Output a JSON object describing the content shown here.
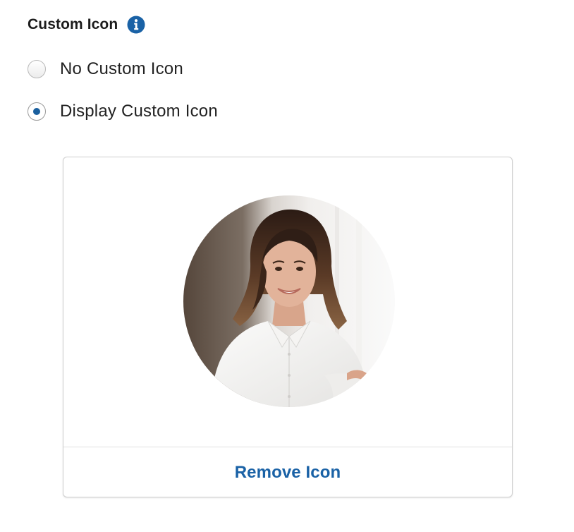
{
  "section": {
    "title": "Custom Icon",
    "info_icon": "info-icon"
  },
  "options": [
    {
      "label": "No Custom Icon",
      "selected": false
    },
    {
      "label": "Display Custom Icon",
      "selected": true
    }
  ],
  "card": {
    "preview": "avatar-photo",
    "remove_label": "Remove Icon"
  },
  "colors": {
    "accent": "#1a62a6",
    "radio_checked": "#1a5f9e",
    "card_border": "#cfcfcf"
  }
}
